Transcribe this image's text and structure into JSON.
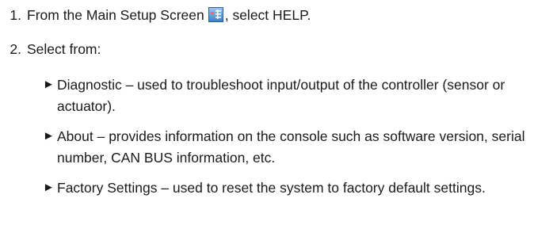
{
  "steps": [
    {
      "number": "1.",
      "text_before_icon": "From the Main Setup Screen",
      "icon": "main-setup-screen-icon",
      "text_after_icon": ", select HELP."
    },
    {
      "number": "2.",
      "text": "Select from:"
    }
  ],
  "options": [
    {
      "marker": "►",
      "text": "Diagnostic – used to troubleshoot input/output of the controller (sensor or actuator)."
    },
    {
      "marker": "►",
      "text": "About – provides information on the console such as software version, serial number, CAN BUS information, etc."
    },
    {
      "marker": "►",
      "text": "Factory Settings – used to reset the system to factory default settings."
    }
  ]
}
